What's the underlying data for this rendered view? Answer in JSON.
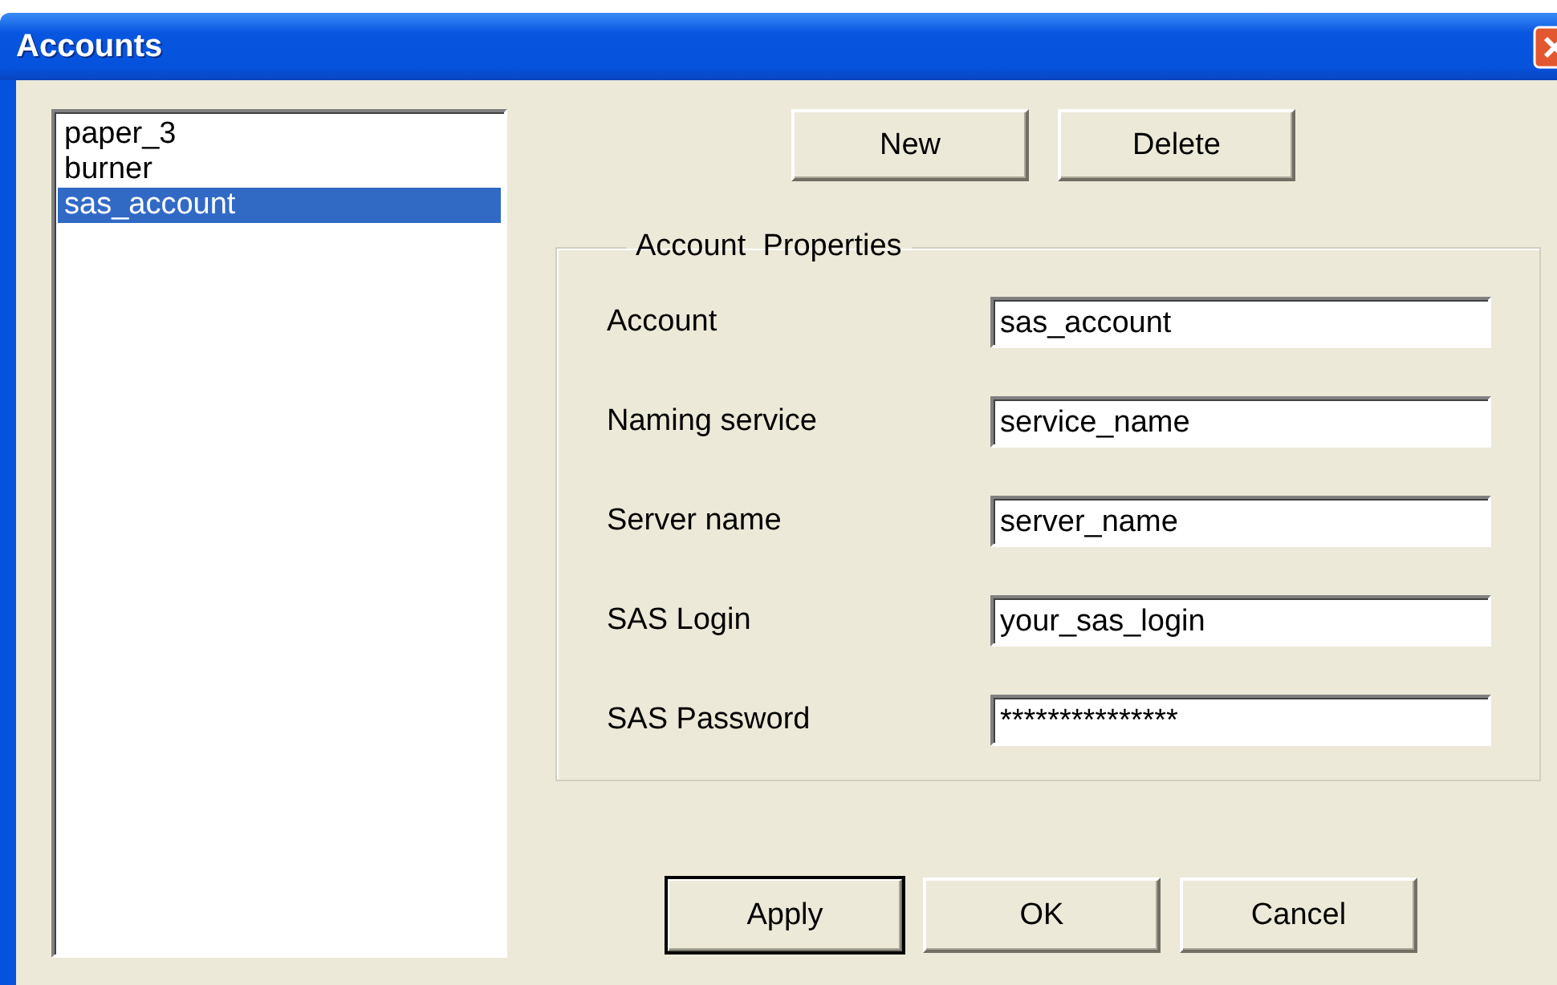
{
  "window": {
    "title": "Accounts"
  },
  "accounts": [
    {
      "label": "paper_3",
      "selected": false
    },
    {
      "label": "burner",
      "selected": false
    },
    {
      "label": "sas_account",
      "selected": true
    }
  ],
  "top_buttons": [
    {
      "label": "New",
      "default": false
    },
    {
      "label": "Delete",
      "default": false
    }
  ],
  "group": {
    "title": "Account  Properties",
    "fields": [
      {
        "label": "Account",
        "value": "sas_account"
      },
      {
        "label": "Naming service",
        "value": "service_name"
      },
      {
        "label": "Server name",
        "value": "server_name"
      },
      {
        "label": "SAS Login",
        "value": "your_sas_login"
      },
      {
        "label": "SAS Password",
        "value": "***************"
      }
    ]
  },
  "bottom_buttons": [
    {
      "label": "Apply",
      "default": true
    },
    {
      "label": "OK",
      "default": false
    },
    {
      "label": "Cancel",
      "default": false
    }
  ]
}
